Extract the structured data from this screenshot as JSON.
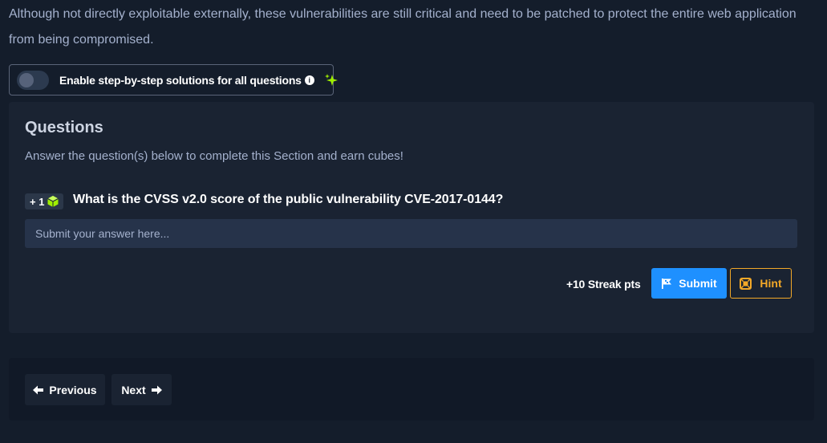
{
  "intro": {
    "text": "Although not directly exploitable externally, these vulnerabilities are still critical and need to be patched to protect the entire web application from being compromised."
  },
  "toggle": {
    "label": "Enable step-by-step solutions for all questions",
    "enabled": false,
    "info_icon": "i"
  },
  "questions": {
    "heading": "Questions",
    "subtitle": "Answer the question(s) below to complete this Section and earn cubes!",
    "items": [
      {
        "badge": "+ 1",
        "text": "What is the CVSS v2.0 score of the public vulnerability CVE-2017-0144?",
        "answer_value": "",
        "answer_placeholder": "Submit your answer here...",
        "streak": "+10 Streak pts",
        "submit_label": "Submit",
        "hint_label": "Hint"
      }
    ]
  },
  "nav": {
    "previous_label": "Previous",
    "next_label": "Next"
  },
  "colors": {
    "background": "#141d2b",
    "card": "#1a2332",
    "accent_blue": "#1e90ff",
    "hint_orange": "#f2a828",
    "cube_green": "#9fef00"
  }
}
